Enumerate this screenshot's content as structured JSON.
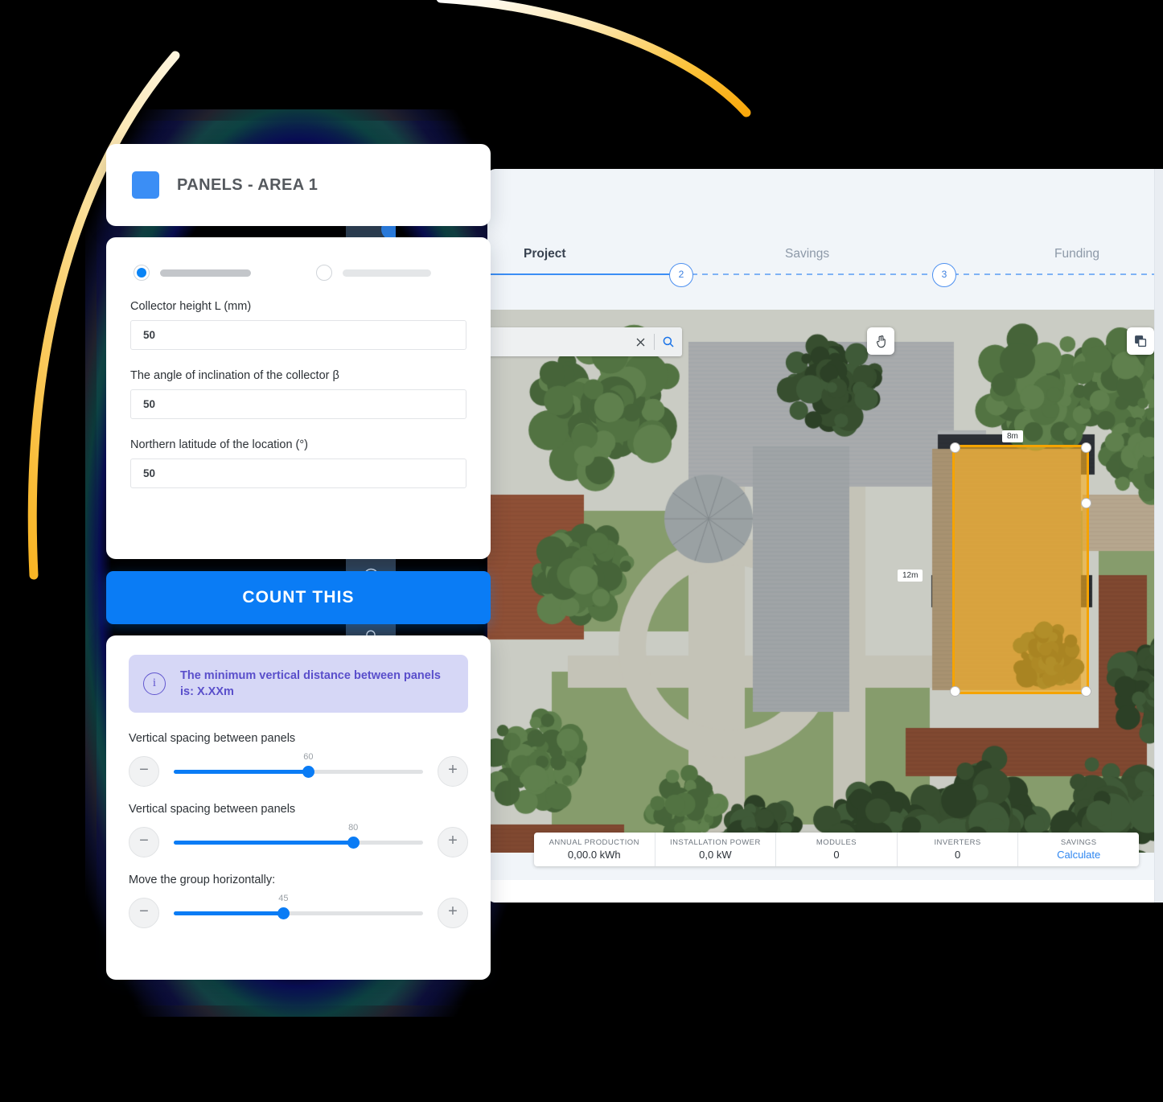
{
  "colors": {
    "accent_blue": "#0a7cf5",
    "step_blue": "#3b8ef5",
    "selection_orange": "#f5a300",
    "info_purple": "#5a4fcb",
    "info_bg": "#d6d7f6",
    "sidebar_dark": "#2f4154",
    "app_bg": "#f1f5f9",
    "arc_orange": "#f9ad17",
    "arc_cream": "#fbe9b8"
  },
  "title_card": {
    "swatch_name": "panel-color-swatch",
    "title": "PANELS - AREA 1"
  },
  "form_card": {
    "radio_options": [
      {
        "selected": true,
        "name": "radio-option-1"
      },
      {
        "selected": false,
        "name": "radio-option-2"
      }
    ],
    "fields": [
      {
        "label": "Collector height L (mm)",
        "value": "50",
        "placeholder": "50"
      },
      {
        "label": "The angle of inclination of the collector β",
        "value": "50",
        "placeholder": "50"
      },
      {
        "label": "Northern latitude of the location (°)",
        "value": "50",
        "placeholder": "50"
      }
    ]
  },
  "count_button": {
    "label": "COUNT THIS"
  },
  "sliders_card": {
    "info": {
      "icon": "info-icon",
      "text": "The minimum vertical distance between panels is: X.XXm"
    },
    "minus_label": "−",
    "plus_label": "+",
    "sliders": [
      {
        "label": "Vertical spacing between panels",
        "value": "60",
        "percent": 54
      },
      {
        "label": "Vertical spacing between panels",
        "value": "80",
        "percent": 72
      },
      {
        "label": "Move the group horizontally:",
        "value": "45",
        "percent": 44
      }
    ]
  },
  "stepper": {
    "steps": [
      {
        "label": "Project",
        "active": true
      },
      {
        "label": "Savings",
        "active": false
      },
      {
        "label": "Funding",
        "active": false
      }
    ],
    "markers": [
      "2",
      "3"
    ]
  },
  "map": {
    "search": {
      "value": "",
      "placeholder": ""
    },
    "clear_icon": "close-icon",
    "search_icon": "search-icon",
    "tools": [
      {
        "name": "pan-tool-button",
        "icon": "hand-pointer-icon"
      },
      {
        "name": "layers-tool-button",
        "icon": "layers-icon"
      }
    ],
    "selection": {
      "top_dimension": "8m",
      "left_dimension": "12m"
    }
  },
  "stats_bar": {
    "items": [
      {
        "header": "ANNUAL PRODUCTION",
        "value": "0,00.0 kWh",
        "link": false
      },
      {
        "header": "INSTALLATION POWER",
        "value": "0,0 kW",
        "link": false
      },
      {
        "header": "MODULES",
        "value": "0",
        "link": false
      },
      {
        "header": "INVERTERS",
        "value": "0",
        "link": false
      },
      {
        "header": "SAVINGS",
        "value": "Calculate",
        "link": true
      }
    ]
  },
  "sidebar": {
    "badge": "",
    "icons": [
      {
        "name": "chat-icon",
        "glyph": "💬"
      },
      {
        "name": "bell-icon",
        "glyph": "🔔"
      }
    ]
  }
}
